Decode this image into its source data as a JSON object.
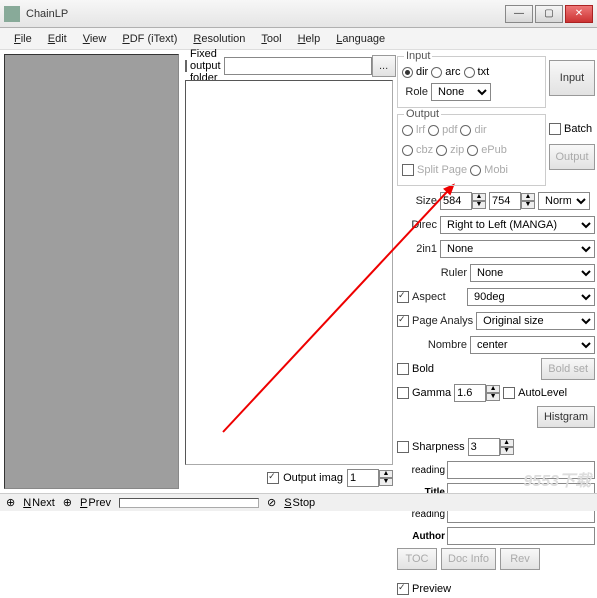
{
  "title": "ChainLP",
  "menu": [
    "File",
    "Edit",
    "View",
    "PDF (iText)",
    "Resolution",
    "Tool",
    "Help",
    "Language"
  ],
  "center": {
    "fixed_output_label": "Fixed output folder",
    "browse_btn": "...",
    "output_imag_label": "Output imag",
    "output_imag_val": "1"
  },
  "input_group": {
    "legend": "Input",
    "dir": "dir",
    "arc": "arc",
    "txt": "txt",
    "role_label": "Role",
    "role_val": "None",
    "input_btn": "Input"
  },
  "output_group": {
    "legend": "Output",
    "lrf": "lrf",
    "pdf": "pdf",
    "dir": "dir",
    "cbz": "cbz",
    "zip": "zip",
    "epub": "ePub",
    "split_label": "Split Page",
    "mobi": "Mobi",
    "batch_label": "Batch",
    "output_btn": "Output"
  },
  "size": {
    "label": "Size",
    "w": "584",
    "h": "754",
    "mode": "Normal"
  },
  "direc": {
    "label": "Direc",
    "val": "Right to Left (MANGA)"
  },
  "twoin1": {
    "label": "2in1",
    "val": "None"
  },
  "ruler": {
    "label": "Ruler",
    "val": "None"
  },
  "aspect": {
    "label": "Aspect",
    "val": "90deg"
  },
  "page_analys": {
    "label": "Page Analys",
    "val": "Original size"
  },
  "nombre": {
    "label": "Nombre",
    "val": "center"
  },
  "bold": {
    "label": "Bold",
    "boldset": "Bold set"
  },
  "gamma": {
    "label": "Gamma",
    "val": "1.6",
    "autolevel": "AutoLevel"
  },
  "histgram": "Histgram",
  "sharpness": {
    "label": "Sharpness",
    "val": "3"
  },
  "reading1": "reading",
  "title_label": "Title",
  "reading2": "reading",
  "author_label": "Author",
  "toc": "TOC",
  "docinfo": "Doc Info",
  "rev": "Rev",
  "preview": "Preview",
  "status": {
    "next": "Next",
    "prev": "Prev",
    "stop": "Stop"
  },
  "watermark": "9553下载"
}
